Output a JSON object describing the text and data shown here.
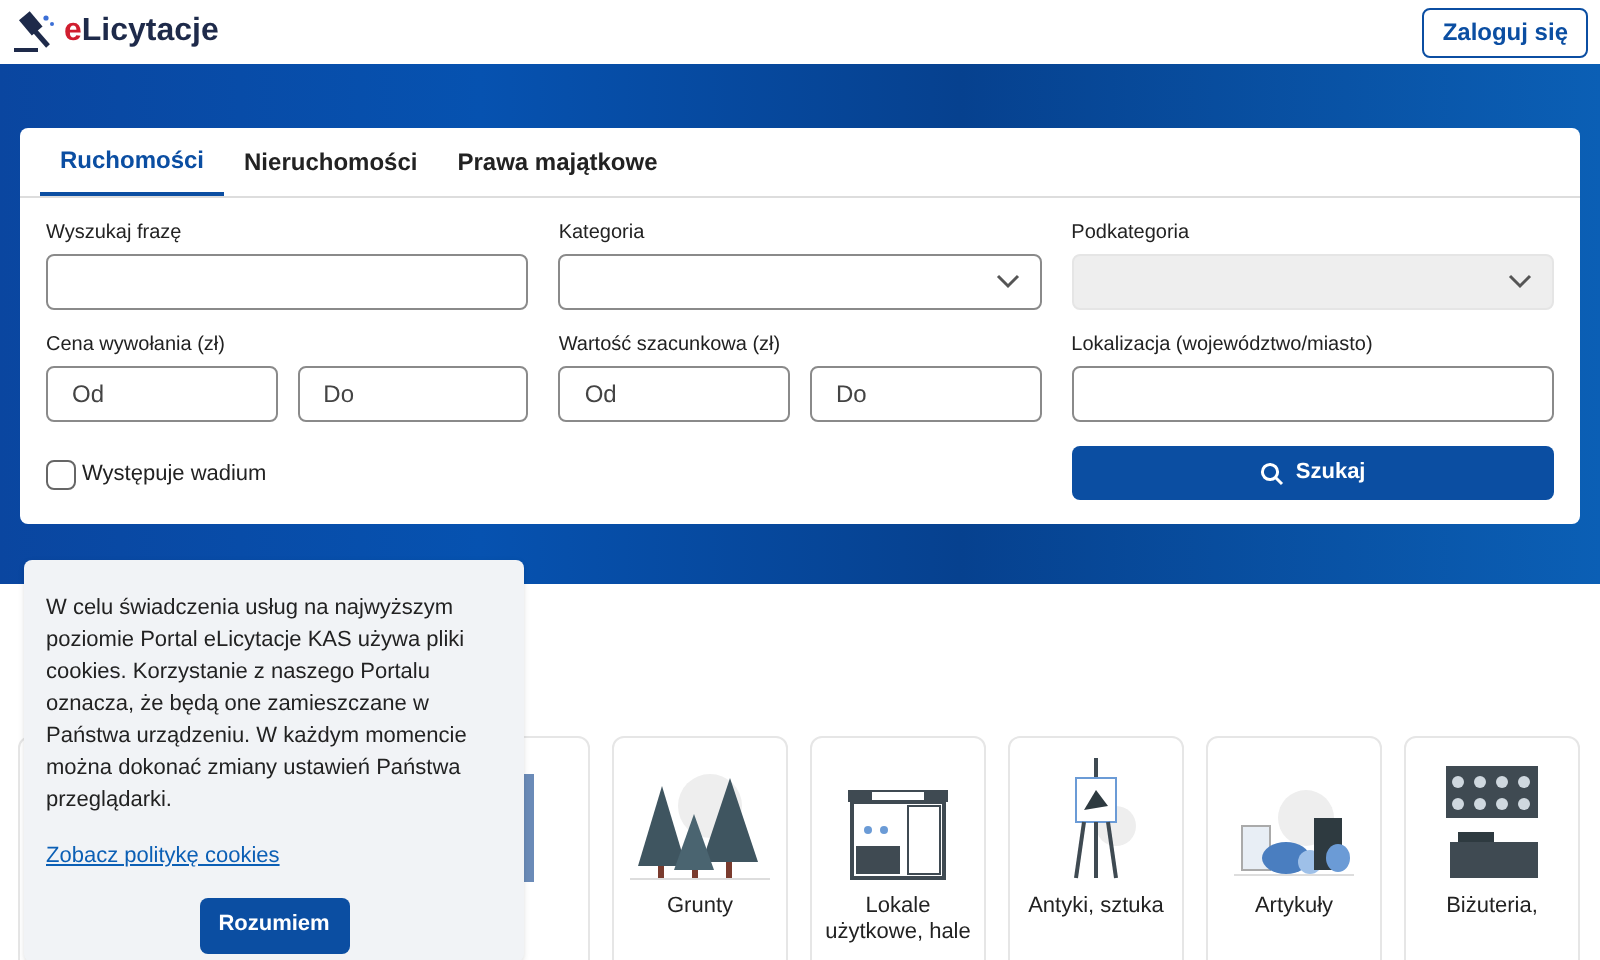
{
  "header": {
    "logo_prefix": "e",
    "logo_rest": "Licytacje",
    "login": "Zaloguj się"
  },
  "tabs": [
    {
      "label": "Ruchomości",
      "selected": true
    },
    {
      "label": "Nieruchomości",
      "selected": false
    },
    {
      "label": "Prawa majątkowe",
      "selected": false
    }
  ],
  "form": {
    "phrase_label": "Wyszukaj frazę",
    "category_label": "Kategoria",
    "subcategory_label": "Podkategoria",
    "subcategory_disabled": true,
    "price_label": "Cena wywołania (zł)",
    "price_from": {
      "placeholder": "Od"
    },
    "price_to": {
      "placeholder": "Do"
    },
    "value_label": "Wartość szacunkowa (zł)",
    "value_from": {
      "placeholder": "Od"
    },
    "value_to": {
      "placeholder": "Do"
    },
    "location_label": "Lokalizacja (województwo/miasto)",
    "wadium_label": "Występuje wadium",
    "wadium_checked": false,
    "search_button": "Szukaj"
  },
  "categories": [
    {
      "kind": "none"
    },
    {
      "kind": "covered"
    },
    {
      "kind": "building"
    },
    {
      "kind": "trees",
      "label": "Grunty"
    },
    {
      "kind": "shop",
      "label": "Lokale użytkowe, hale"
    },
    {
      "kind": "easel",
      "label": "Antyki, sztuka"
    },
    {
      "kind": "goods",
      "label": "Artykuły"
    },
    {
      "kind": "jewelry",
      "label": "Biżuteria,"
    }
  ],
  "cookie": {
    "text": "W celu świadczenia usług na najwyższym poziomie Portal eLicytacje KAS używa pliki cookies. Korzystanie z naszego Portalu oznacza, że będą one zamieszczane w Państwa urządzeniu. W każdym momencie można dokonać zmiany ustawień Państwa przeglądarki.",
    "link": "Zobacz politykę cookies",
    "button": "Rozumiem"
  }
}
